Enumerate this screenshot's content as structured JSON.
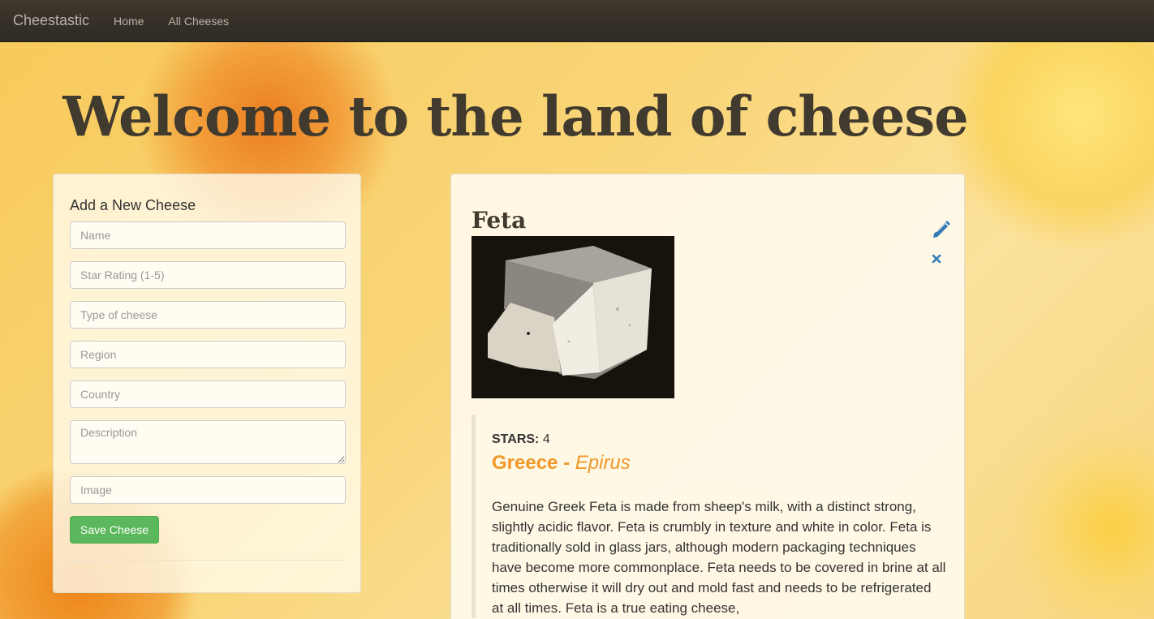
{
  "navbar": {
    "brand": "Cheestastic",
    "links": [
      "Home",
      "All Cheeses"
    ]
  },
  "hero": {
    "title": "Welcome to the land of cheese"
  },
  "form": {
    "heading": "Add a New Cheese",
    "fields": {
      "name": {
        "placeholder": "Name",
        "value": ""
      },
      "star_rating": {
        "placeholder": "Star Rating (1-5)",
        "value": ""
      },
      "type": {
        "placeholder": "Type of cheese",
        "value": ""
      },
      "region": {
        "placeholder": "Region",
        "value": ""
      },
      "country": {
        "placeholder": "Country",
        "value": ""
      },
      "description": {
        "placeholder": "Description",
        "value": ""
      },
      "image": {
        "placeholder": "Image",
        "value": ""
      }
    },
    "save_label": "Save Cheese"
  },
  "cheese": {
    "name": "Feta",
    "stars_label": "STARS:",
    "stars": "4",
    "country": "Greece",
    "separator": "-",
    "region": "Epirus",
    "description": "Genuine Greek Feta is made from sheep's milk, with a distinct strong, slightly acidic flavor. Feta is crumbly in texture and white in color. Feta is traditionally sold in glass jars, although modern packaging techniques have become more commonplace. Feta needs to be covered in brine at all times otherwise it will dry out and mold fast and needs to be refrigerated at all times. Feta is a true eating cheese,",
    "edit_icon": "pencil-icon",
    "delete_icon": "close-icon"
  },
  "colors": {
    "navbar": "#2f2a22",
    "accent_orange": "#f0982a",
    "save_green": "#5cb85c",
    "icon_blue": "#337ab7",
    "title_dark": "#413a2e"
  }
}
